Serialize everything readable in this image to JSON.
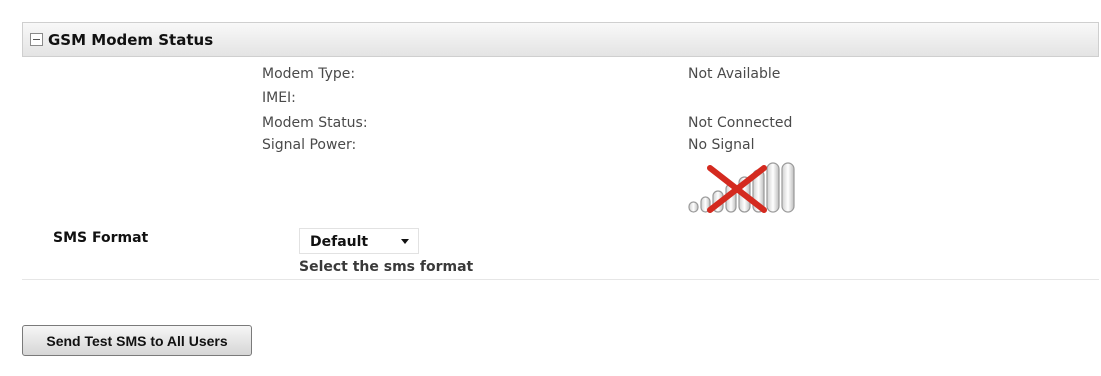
{
  "panel": {
    "title": "GSM Modem Status",
    "collapse_icon": "collapse-minus-icon"
  },
  "status": {
    "modem_type_label": "Modem Type:",
    "modem_type_value": "Not Available",
    "imei_label": "IMEI:",
    "imei_value": "",
    "modem_status_label": "Modem Status:",
    "modem_status_value": "Not Connected",
    "signal_power_label": "Signal Power:",
    "signal_power_value": "No Signal",
    "signal_icon": "no-signal-icon",
    "signal_bars_active": 0
  },
  "sms": {
    "format_label": "SMS Format",
    "format_selected": "Default",
    "format_help": "Select the sms format"
  },
  "actions": {
    "send_test_label": "Send Test SMS to All Users"
  },
  "colors": {
    "header_bg": "#e8e8e8",
    "no_signal_x": "#d42a1f"
  }
}
